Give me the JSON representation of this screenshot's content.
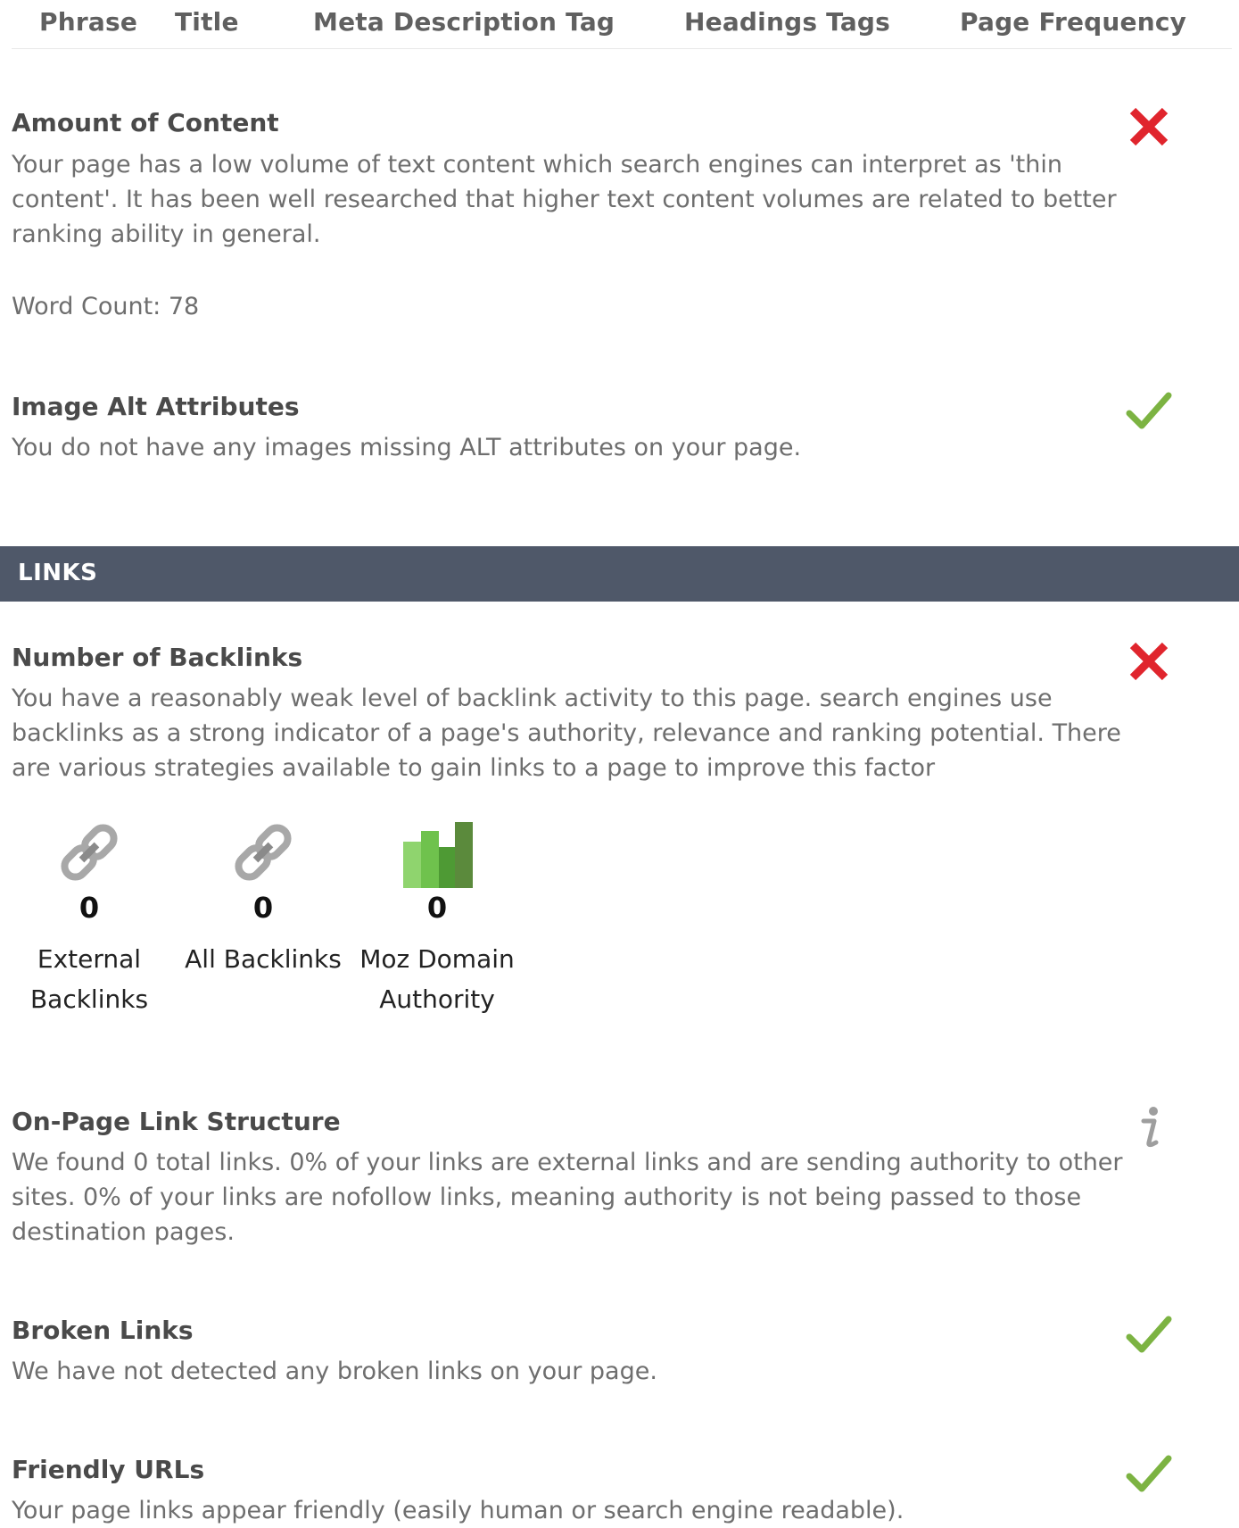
{
  "table_header": {
    "columns": [
      "Phrase",
      "Title",
      "Meta Description Tag",
      "Headings Tags",
      "Page Frequency"
    ]
  },
  "sections": {
    "amount_of_content": {
      "title": "Amount of Content",
      "description": "Your page has a low volume of text content which search engines can interpret as 'thin content'. It has been well researched that higher text content volumes are related to better ranking ability in general.",
      "word_count": "Word Count: 78",
      "status": "fail"
    },
    "image_alt": {
      "title": "Image Alt Attributes",
      "description": "You do not have any images missing ALT attributes on your page.",
      "status": "pass"
    }
  },
  "links_band": {
    "label": "LINKS"
  },
  "links": {
    "backlinks": {
      "title": "Number of Backlinks",
      "description": "You have a reasonably weak level of backlink activity to this page. search engines use backlinks as a strong indicator of a page's authority, relevance and ranking potential. There are various strategies available to gain links to a page to improve this factor",
      "status": "fail",
      "metrics": [
        {
          "value": "0",
          "label": "External Backlinks",
          "icon": "chain-link-icon"
        },
        {
          "value": "0",
          "label": "All Backlinks",
          "icon": "chain-link-icon"
        },
        {
          "value": "0",
          "label": "Moz Domain Authority",
          "icon": "bar-chart-icon"
        }
      ]
    },
    "link_structure": {
      "title": "On-Page Link Structure",
      "description": "We found 0 total links. 0% of your links are external links and are sending authority to other sites. 0% of your links are nofollow links, meaning authority is not being passed to those destination pages.",
      "status": "info"
    },
    "broken_links": {
      "title": "Broken Links",
      "description": "We have not detected any broken links on your page.",
      "status": "pass"
    },
    "friendly_urls": {
      "title": "Friendly URLs",
      "description": "Your page links appear friendly (easily human or search engine readable).",
      "status": "pass"
    }
  },
  "colors": {
    "pass": "#7cb342",
    "fail": "#e0252d",
    "info": "#9e9e9e",
    "band": "#4f5869"
  }
}
